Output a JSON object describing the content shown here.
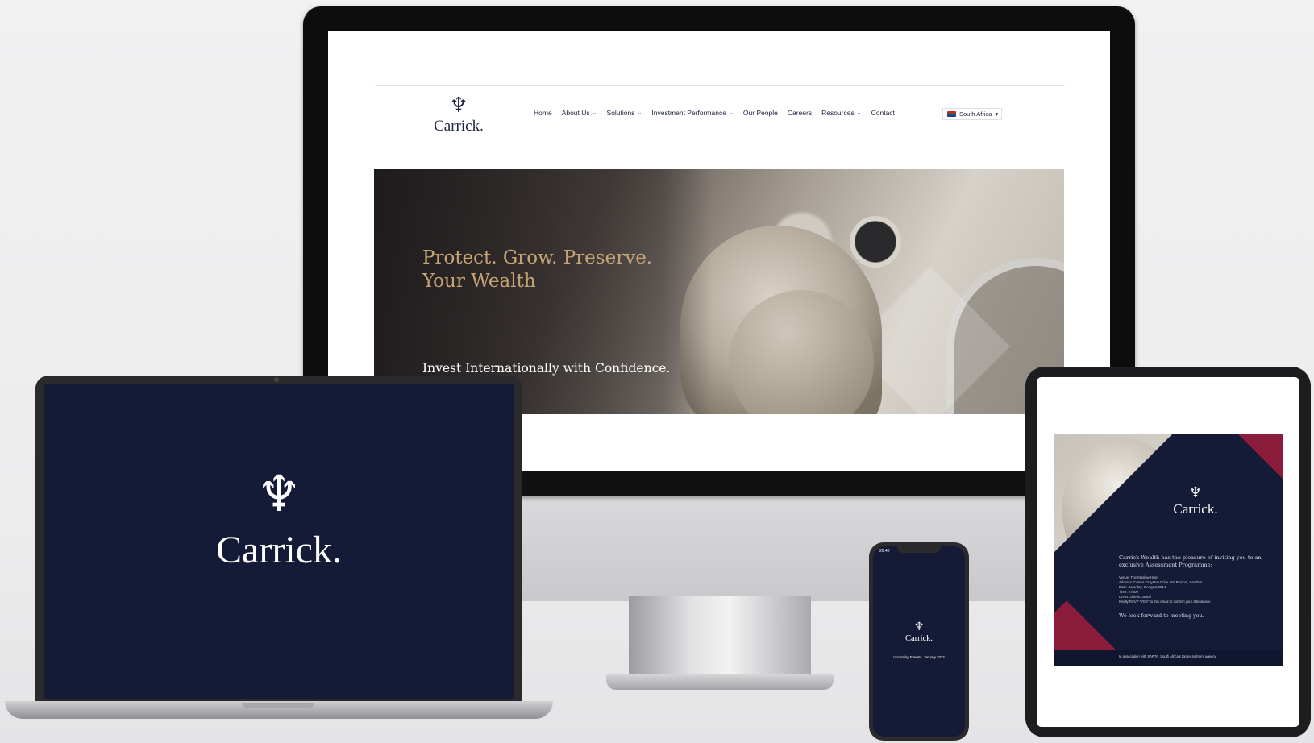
{
  "website": {
    "logo_icon": "trident-icon",
    "logo_text": "Carrick.",
    "nav": [
      {
        "label": "Home",
        "dropdown": false
      },
      {
        "label": "About Us",
        "dropdown": true
      },
      {
        "label": "Solutions",
        "dropdown": true
      },
      {
        "label": "Investment Performance",
        "dropdown": true
      },
      {
        "label": "Our People",
        "dropdown": false
      },
      {
        "label": "Careers",
        "dropdown": false
      },
      {
        "label": "Resources",
        "dropdown": true
      },
      {
        "label": "Contact",
        "dropdown": false
      }
    ],
    "region_select": "South Africa",
    "hero": {
      "title": "Protect. Grow. Preserve.\nYour Wealth",
      "subtitle": "Invest Internationally with Confidence."
    }
  },
  "laptop": {
    "logo_text": "Carrick."
  },
  "phone": {
    "status_time": "20:40",
    "logo_text": "Carrick.",
    "events_label": "Upcoming Events",
    "events_date": "January 2023"
  },
  "tablet": {
    "logo_text": "Carrick.",
    "lead": "Carrick Wealth has the pleasure of inviting you to an exclusive Assessment Programme:",
    "details": [
      "Venue: The Maslow Hotel",
      "Address: Corner Grayston Drive and Rivonia, Sandton",
      "Date: Saturday, 9 August 2014",
      "Time: 07h00",
      "Dress code is casual",
      "Kindly RSVP \"YES\" to this email to confirm your attendance"
    ],
    "closing": "We look forward to meeting you.",
    "footer": "In association with SARTA, South Africa's top recruitment agency."
  },
  "colors": {
    "navy": "#151b36",
    "gold": "#c6a476",
    "burgundy": "#8c1c3b"
  }
}
